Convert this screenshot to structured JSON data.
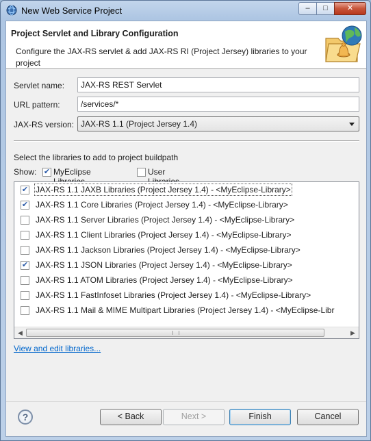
{
  "window": {
    "title": "New Web Service Project",
    "icon": "eclipse-globe-icon",
    "minimize_glyph": "–",
    "maximize_glyph": "□",
    "close_glyph": "✕"
  },
  "banner": {
    "title": "Project Servlet and Library Configuration",
    "description": "Configure the JAX-RS servlet & add JAX-RS RI (Project Jersey) libraries to your project",
    "icon": "web-service-wizard-icon"
  },
  "form": {
    "servlet_name_label": "Servlet name:",
    "servlet_name_value": "JAX-RS REST Servlet",
    "url_pattern_label": "URL pattern:",
    "url_pattern_value": "/services/*",
    "jaxrs_version_label": "JAX-RS version:",
    "jaxrs_version_value": "JAX-RS 1.1 (Project Jersey 1.4)"
  },
  "libraries": {
    "section_label": "Select the libraries to add to project buildpath",
    "show_label": "Show:",
    "filter_myeclipse_label": "MyEclipse Libraries",
    "filter_myeclipse_checked": true,
    "filter_user_label": "User Libraries",
    "filter_user_checked": false,
    "items": [
      {
        "label": "JAX-RS 1.1 JAXB Libraries (Project Jersey 1.4) - <MyEclipse-Library>",
        "checked": true
      },
      {
        "label": "JAX-RS 1.1 Core Libraries (Project Jersey 1.4) - <MyEclipse-Library>",
        "checked": true
      },
      {
        "label": "JAX-RS 1.1 Server Libraries (Project Jersey 1.4) - <MyEclipse-Library>",
        "checked": false
      },
      {
        "label": "JAX-RS 1.1 Client Libraries (Project Jersey 1.4) - <MyEclipse-Library>",
        "checked": false
      },
      {
        "label": "JAX-RS 1.1 Jackson Libraries (Project Jersey 1.4) - <MyEclipse-Library>",
        "checked": false
      },
      {
        "label": "JAX-RS 1.1 JSON Libraries (Project Jersey 1.4) - <MyEclipse-Library>",
        "checked": true
      },
      {
        "label": "JAX-RS 1.1 ATOM Libraries (Project Jersey 1.4) - <MyEclipse-Library>",
        "checked": false
      },
      {
        "label": "JAX-RS 1.1 FastInfoset Libraries (Project Jersey 1.4) - <MyEclipse-Library>",
        "checked": false
      },
      {
        "label": "JAX-RS 1.1 Mail & MIME Multipart Libraries (Project Jersey 1.4) - <MyEclipse-Libr",
        "checked": false
      }
    ],
    "view_edit_link": "View and edit libraries..."
  },
  "buttons": {
    "help_glyph": "?",
    "back_label": "< Back",
    "next_label": "Next >",
    "finish_label": "Finish",
    "cancel_label": "Cancel"
  },
  "colors": {
    "link": "#0066cc",
    "checkmark": "#2a5aa8"
  }
}
